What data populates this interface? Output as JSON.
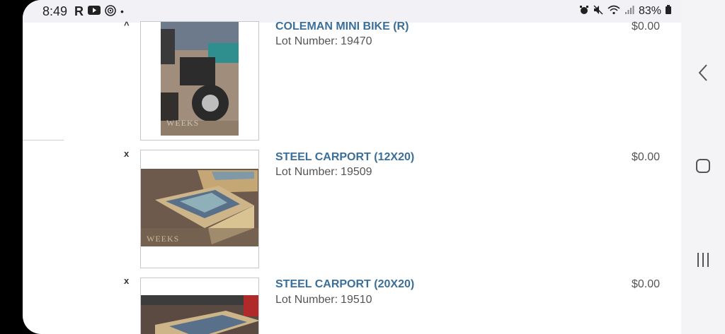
{
  "status": {
    "time": "8:49",
    "app_icons": [
      "R",
      "youtube-icon",
      "podcast-icon",
      "dot"
    ],
    "battery": "83%"
  },
  "items": [
    {
      "remove": "^",
      "title": "COLEMAN MINI BIKE (R)",
      "lot_label": "Lot Number:",
      "lot_number": "19470",
      "price": "$0.00",
      "watermark": "WEEKS"
    },
    {
      "remove": "x",
      "title": "STEEL CARPORT (12X20)",
      "lot_label": "Lot Number:",
      "lot_number": "19509",
      "price": "$0.00",
      "watermark": "WEEKS"
    },
    {
      "remove": "x",
      "title": "STEEL CARPORT (20X20)",
      "lot_label": "Lot Number:",
      "lot_number": "19510",
      "price": "$0.00"
    }
  ],
  "colors": {
    "title": "#3a6f9a",
    "text": "#555555",
    "statusbar_bg": "#f2f2f6",
    "navbar_bg": "#f4f4f6"
  }
}
